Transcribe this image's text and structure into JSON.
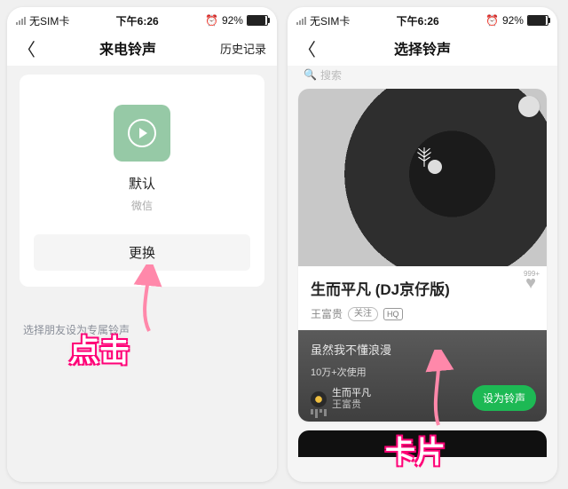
{
  "status": {
    "carrier": "无SIM卡",
    "time": "下午6:26",
    "battery_pct": "92%"
  },
  "left": {
    "nav_title": "来电铃声",
    "nav_action": "历史记录",
    "tone_name": "默认",
    "tone_source": "微信",
    "swap_label": "更换",
    "tip": "选择朋友设为专属铃声"
  },
  "right": {
    "nav_title": "选择铃声",
    "search_placeholder": "搜索",
    "song_title": "生而平凡 (DJ京仔版)",
    "artist": "王富贵",
    "follow_label": "关注",
    "hq_label": "HQ",
    "like_count": "999+",
    "lyric": "虽然我不懂浪漫",
    "use_count": "10万+次使用",
    "now_title": "生而平凡",
    "now_artist": "王富贵",
    "set_label": "设为铃声"
  },
  "annotations": {
    "left_label": "点击",
    "right_label": "卡片"
  }
}
